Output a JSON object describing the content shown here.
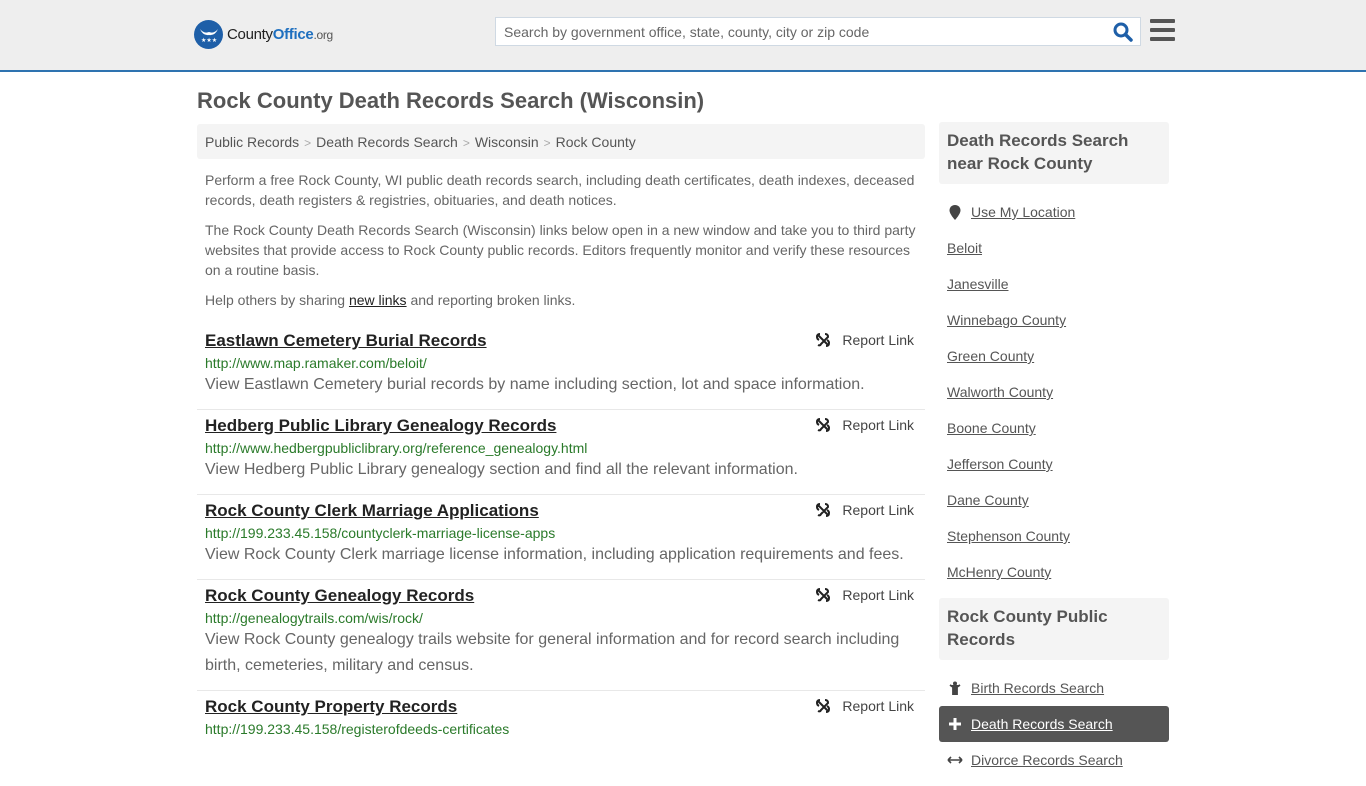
{
  "header": {
    "logo": {
      "county": "County",
      "office": "Office",
      "tld": ".org"
    },
    "search": {
      "placeholder": "Search by government office, state, county, city or zip code",
      "value": ""
    },
    "icons": {
      "search": "search-icon",
      "menu": "hamburger-menu-icon"
    }
  },
  "page": {
    "title": "Rock County Death Records Search (Wisconsin)",
    "breadcrumb": [
      "Public Records",
      "Death Records Search",
      "Wisconsin",
      "Rock County"
    ],
    "intro1": "Perform a free Rock County, WI public death records search, including death certificates, death indexes, deceased records, death registers & registries, obituaries, and death notices.",
    "intro2": "The Rock County Death Records Search (Wisconsin) links below open in a new window and take you to third party websites that provide access to Rock County public records. Editors frequently monitor and verify these resources on a routine basis.",
    "help_prefix": "Help others by sharing ",
    "help_link": "new links",
    "help_suffix": " and reporting broken links."
  },
  "results": [
    {
      "title": "Eastlawn Cemetery Burial Records",
      "url": "http://www.map.ramaker.com/beloit/",
      "desc": "View Eastlawn Cemetery burial records by name including section, lot and space information.",
      "report": "Report Link"
    },
    {
      "title": "Hedberg Public Library Genealogy Records",
      "url": "http://www.hedbergpubliclibrary.org/reference_genealogy.html",
      "desc": "View Hedberg Public Library genealogy section and find all the relevant information.",
      "report": "Report Link"
    },
    {
      "title": "Rock County Clerk Marriage Applications",
      "url": "http://199.233.45.158/countyclerk-marriage-license-apps",
      "desc": "View Rock County Clerk marriage license information, including application requirements and fees.",
      "report": "Report Link"
    },
    {
      "title": "Rock County Genealogy Records",
      "url": "http://genealogytrails.com/wis/rock/",
      "desc": "View Rock County genealogy trails website for general information and for record search including birth, cemeteries, military and census.",
      "report": "Report Link"
    },
    {
      "title": "Rock County Property Records",
      "url": "http://199.233.45.158/registerofdeeds-certificates",
      "desc": "",
      "report": "Report Link"
    }
  ],
  "sidebar": {
    "nearby_title": "Death Records Search near Rock County",
    "use_location": "Use My Location",
    "nearby": [
      "Beloit",
      "Janesville",
      "Winnebago County",
      "Green County",
      "Walworth County",
      "Boone County",
      "Jefferson County",
      "Dane County",
      "Stephenson County",
      "McHenry County"
    ],
    "public_title": "Rock County Public Records",
    "public": [
      {
        "label": "Birth Records Search",
        "icon": "baby-icon",
        "active": false
      },
      {
        "label": "Death Records Search",
        "icon": "plus-cross-icon",
        "active": true
      },
      {
        "label": "Divorce Records Search",
        "icon": "arrows-split-icon",
        "active": false
      }
    ]
  },
  "colors": {
    "accent": "#2e73b0",
    "url_green": "#2a7a2a",
    "active_bg": "#555555"
  }
}
